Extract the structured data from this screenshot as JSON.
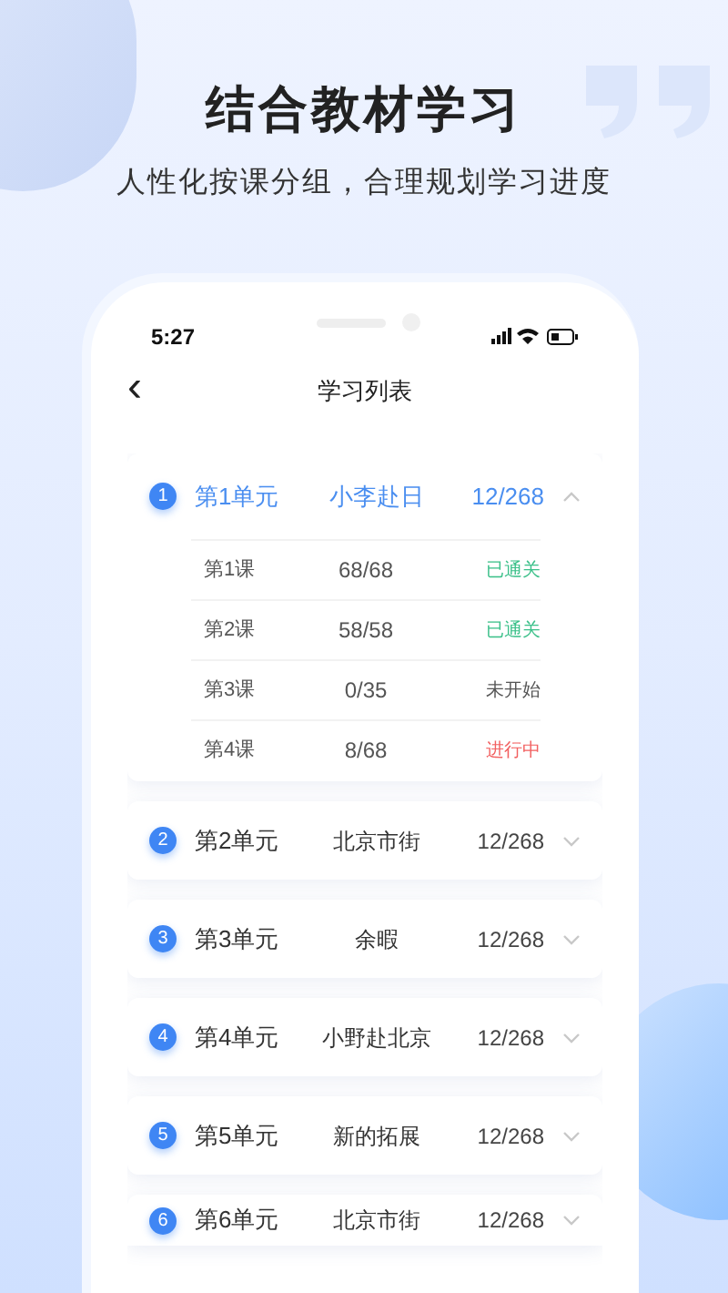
{
  "headline": "结合教材学习",
  "subtitle": "人性化按课分组，合理规划学习进度",
  "status_bar": {
    "time": "5:27"
  },
  "nav": {
    "back": "‹",
    "title": "学习列表"
  },
  "units": [
    {
      "number": "1",
      "name": "第1单元",
      "topic": "小李赴日",
      "progress": "12/268",
      "expanded": true,
      "lessons": [
        {
          "name": "第1课",
          "progress": "68/68",
          "status": "已通关",
          "kind": "passed"
        },
        {
          "name": "第2课",
          "progress": "58/58",
          "status": "已通关",
          "kind": "passed"
        },
        {
          "name": "第3课",
          "progress": "0/35",
          "status": "未开始",
          "kind": "not_started"
        },
        {
          "name": "第4课",
          "progress": "8/68",
          "status": "进行中",
          "kind": "in_progress"
        }
      ]
    },
    {
      "number": "2",
      "name": "第2单元",
      "topic": "北京市街",
      "progress": "12/268",
      "expanded": false
    },
    {
      "number": "3",
      "name": "第3单元",
      "topic": "余暇",
      "progress": "12/268",
      "expanded": false
    },
    {
      "number": "4",
      "name": "第4单元",
      "topic": "小野赴北京",
      "progress": "12/268",
      "expanded": false
    },
    {
      "number": "5",
      "name": "第5单元",
      "topic": "新的拓展",
      "progress": "12/268",
      "expanded": false
    },
    {
      "number": "6",
      "name": "第6单元",
      "topic": "北京市街",
      "progress": "12/268",
      "expanded": false
    }
  ]
}
